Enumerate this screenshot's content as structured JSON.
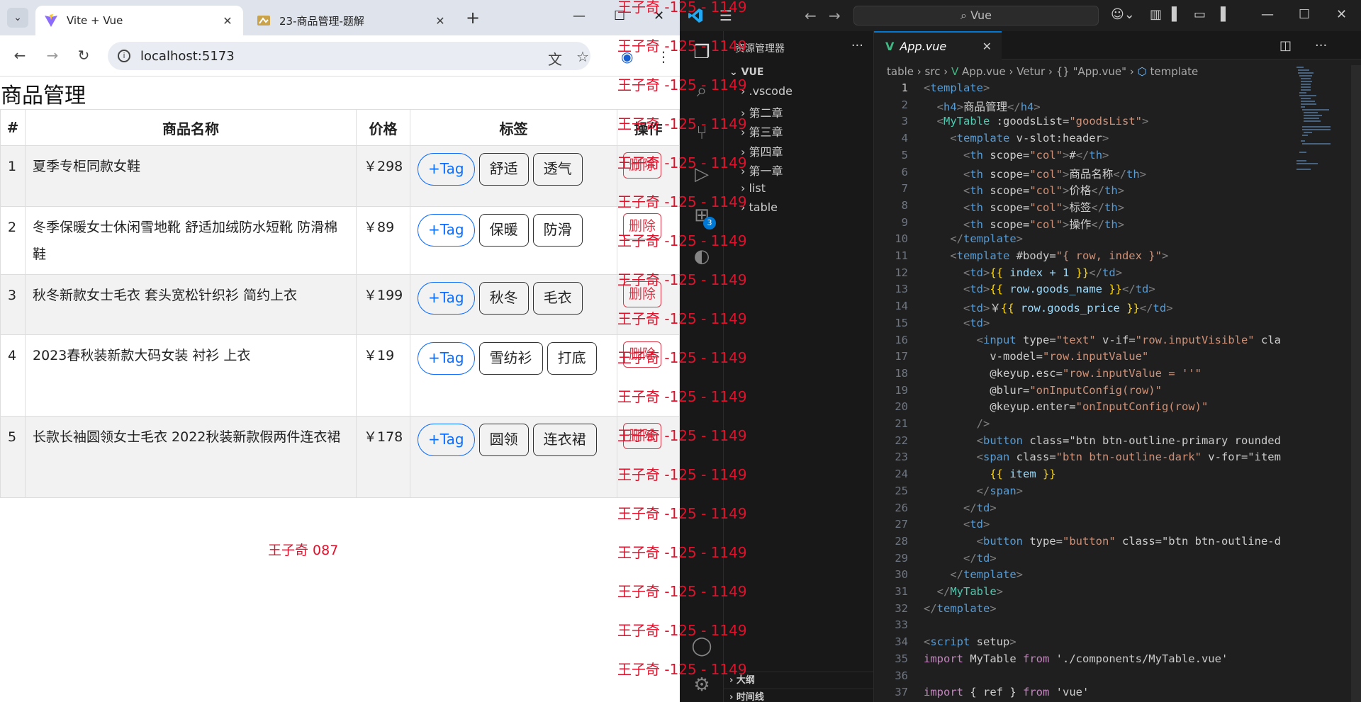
{
  "browser": {
    "tabs": [
      {
        "title": "Vite + Vue",
        "active": true
      },
      {
        "title": "23-商品管理-题解",
        "active": false
      }
    ],
    "url": "localhost:5173"
  },
  "page": {
    "heading": "商品管理",
    "columns": [
      "#",
      "商品名称",
      "价格",
      "标签",
      "操作"
    ],
    "rows": [
      {
        "index": "1",
        "name": "夏季专柜同款女鞋",
        "price": "￥298",
        "tags": [
          "舒适",
          "透气"
        ]
      },
      {
        "index": "2",
        "name": "冬季保暖女士休闲雪地靴 舒适加绒防水短靴 防滑棉鞋",
        "price": "￥89",
        "tags": [
          "保暖",
          "防滑"
        ]
      },
      {
        "index": "3",
        "name": "秋冬新款女士毛衣 套头宽松针织衫 简约上衣",
        "price": "￥199",
        "tags": [
          "秋冬",
          "毛衣"
        ]
      },
      {
        "index": "4",
        "name": "2023春秋装新款大码女装 衬衫 上衣",
        "price": "￥19",
        "tags": [
          "雪纺衫",
          "打底"
        ]
      },
      {
        "index": "5",
        "name": "长款长袖圆领女士毛衣 2022秋装新款假两件连衣裙",
        "price": "￥178",
        "tags": [
          "圆领",
          "连衣裙"
        ]
      }
    ],
    "add_tag_label": "+Tag",
    "delete_label": "删除",
    "signature": "王子奇 087"
  },
  "watermark": "王子奇 -125 - 1149",
  "vscode": {
    "search": "Vue",
    "explorer_title": "资源管理器",
    "explorer_items": [
      {
        "label": "VUE",
        "root": true
      },
      {
        "label": ".vscode"
      },
      {
        "label": "第二章"
      },
      {
        "label": "第三章"
      },
      {
        "label": "第四章"
      },
      {
        "label": "第一章"
      },
      {
        "label": "list"
      },
      {
        "label": "table"
      }
    ],
    "outline_label": "大纲",
    "timeline_label": "时间线",
    "editor_tab": "App.vue",
    "breadcrumb": [
      "table",
      "src",
      "App.vue",
      "Vetur",
      "{} \"App.vue\"",
      "template"
    ],
    "extensions_badge": "3",
    "code_lines": [
      "<template>",
      "  <h4>商品管理</h4>",
      "  <MyTable :goodsList=\"goodsList\">",
      "    <template v-slot:header>",
      "      <th scope=\"col\">#</th>",
      "      <th scope=\"col\">商品名称</th>",
      "      <th scope=\"col\">价格</th>",
      "      <th scope=\"col\">标签</th>",
      "      <th scope=\"col\">操作</th>",
      "    </template>",
      "    <template #body=\"{ row, index }\">",
      "      <td>{{ index + 1 }}</td>",
      "      <td>{{ row.goods_name }}</td>",
      "      <td>￥{{ row.goods_price }}</td>",
      "      <td>",
      "        <input type=\"text\" v-if=\"row.inputVisible\" cla",
      "          v-model=\"row.inputValue\"",
      "          @keyup.esc=\"row.inputValue = ''\"",
      "          @blur=\"onInputConfig(row)\"",
      "          @keyup.enter=\"onInputConfig(row)\"",
      "        />",
      "        <button class=\"btn btn-outline-primary rounded",
      "        <span class=\"btn btn-outline-dark\" v-for=\"item",
      "          {{ item }}",
      "        </span>",
      "      </td>",
      "      <td>",
      "        <button type=\"button\" class=\"btn btn-outline-d",
      "      </td>",
      "    </template>",
      "  </MyTable>",
      "</template>",
      "",
      "<script setup>",
      "import MyTable from './components/MyTable.vue'",
      "",
      "import { ref } from 'vue'"
    ]
  }
}
